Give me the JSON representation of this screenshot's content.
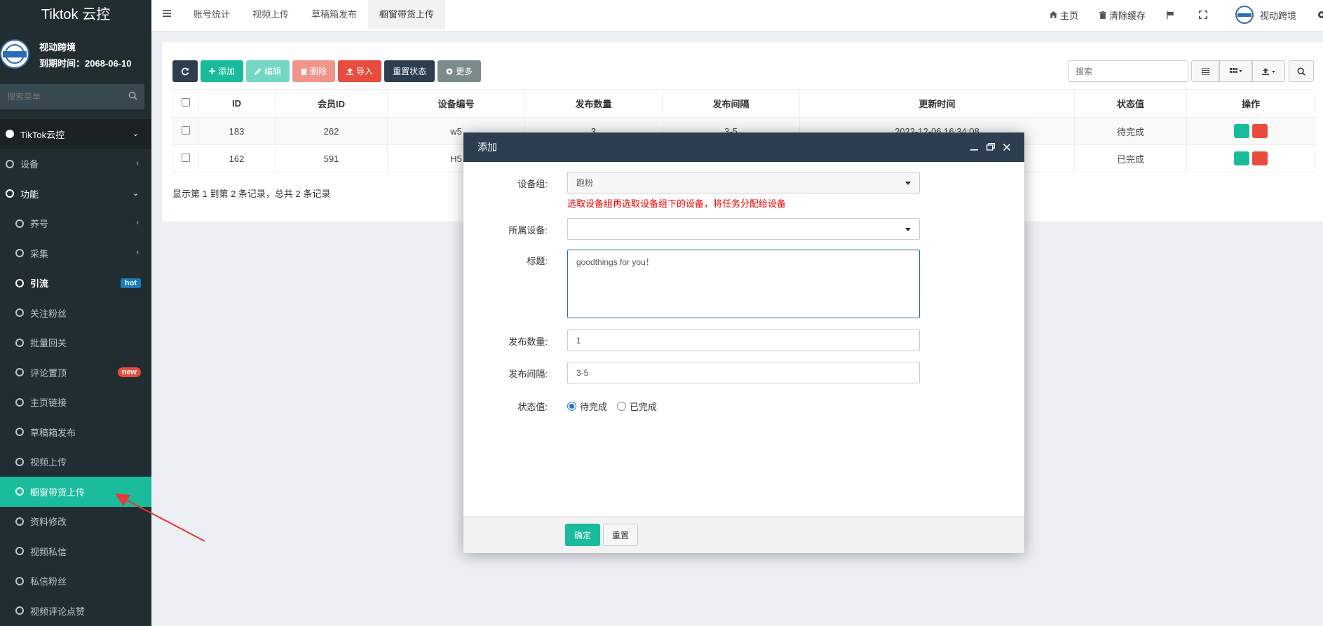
{
  "app": {
    "title": "Tiktok 云控"
  },
  "user": {
    "name": "视动跨境",
    "expire": "到期时间：2068-06-10"
  },
  "sidebar": {
    "search_placeholder": "搜索菜单",
    "items": [
      {
        "label": "TikTok云控"
      },
      {
        "label": "设备"
      },
      {
        "label": "功能"
      },
      {
        "label": "养号"
      },
      {
        "label": "采集"
      },
      {
        "label": "引流",
        "badge": "hot"
      },
      {
        "label": "关注粉丝"
      },
      {
        "label": "批量回关"
      },
      {
        "label": "评论置顶",
        "badge": "new"
      },
      {
        "label": "主页链接"
      },
      {
        "label": "草稿箱发布"
      },
      {
        "label": "视频上传"
      },
      {
        "label": "橱窗带货上传"
      },
      {
        "label": "资料修改"
      },
      {
        "label": "视频私信"
      },
      {
        "label": "私信粉丝"
      },
      {
        "label": "视频评论点赞"
      }
    ]
  },
  "topbar": {
    "tabs": [
      "账号统计",
      "视频上传",
      "草稿箱发布",
      "橱窗带货上传"
    ],
    "home": "主页",
    "clear_cache": "清除缓存",
    "username": "视动跨境"
  },
  "toolbar": {
    "add": "添加",
    "edit": "编辑",
    "delete": "删除",
    "import": "导入",
    "reset_status": "重置状态",
    "more": "更多",
    "search_placeholder": "搜索"
  },
  "table": {
    "headers": [
      "ID",
      "会员ID",
      "设备编号",
      "发布数量",
      "发布间隔",
      "更新时间",
      "状态值",
      "操作"
    ],
    "rows": [
      {
        "id": "183",
        "member": "262",
        "device": "w5",
        "count": "3",
        "interval": "3-5",
        "time": "2022-12-06 16:34:08",
        "status": "待完成"
      },
      {
        "id": "162",
        "member": "591",
        "device": "H5",
        "count": "",
        "interval": "",
        "time": "",
        "status": "已完成"
      }
    ],
    "records": "显示第 1 到第 2 条记录，总共 2 条记录"
  },
  "modal": {
    "title": "添加",
    "group_label": "设备组:",
    "group_value": "跑粉",
    "group_hint": "选取设备组再选取设备组下的设备，将任务分配给设备",
    "device_label": "所属设备:",
    "device_value": "",
    "title_label": "标题:",
    "title_value": "goodthings for you！",
    "count_label": "发布数量:",
    "count_value": "1",
    "interval_label": "发布间隔:",
    "interval_value": "3-5",
    "status_label": "状态值:",
    "status_pending": "待完成",
    "status_done": "已完成",
    "ok": "确定",
    "reset": "重置"
  },
  "colors": {
    "sidebar_bg": "#222d32",
    "accent": "#18bc9c",
    "danger": "#e74c3c",
    "dark": "#2c3e50"
  }
}
